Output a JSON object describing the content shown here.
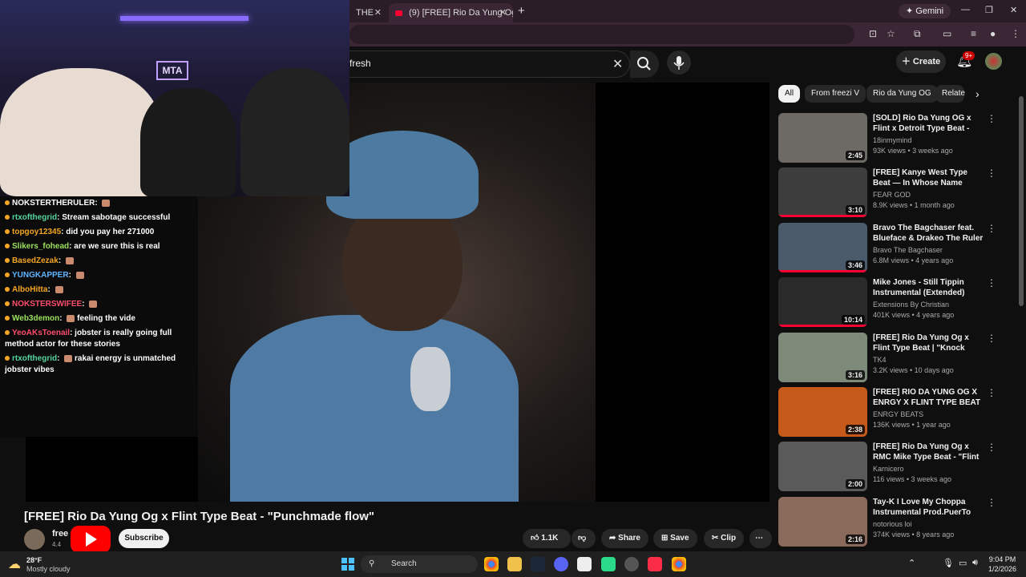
{
  "browser": {
    "tabs": [
      {
        "label": "THE",
        "active": false
      },
      {
        "label": "(9) [FREE] Rio Da Yung Og",
        "active": true
      }
    ],
    "new_tab": "+",
    "gemini": "Gemini"
  },
  "youtube": {
    "search_value": "fresh",
    "create_label": "Create",
    "notif_count": "9+",
    "chips": [
      "All",
      "From freezi V",
      "Rio da Yung OG",
      "Relate"
    ],
    "main": {
      "title": "[FREE] Rio Da Yung Og x Flint Type Beat - \"Punchmade flow\"",
      "channel": "free",
      "subs": "4.4",
      "subscribe": "Subscribe",
      "likes": "1.1K",
      "share": "Share",
      "save": "Save",
      "clip": "Clip"
    },
    "videos": [
      {
        "title": "[SOLD] Rio Da Yung OG x Flint x Detroit Type Beat - \"Haunted\"",
        "channel": "18inmymind",
        "meta": "93K views • 3 weeks ago",
        "duration": "2:45",
        "progress": 0
      },
      {
        "title": "[FREE] Kanye West Type Beat — In Whose Name",
        "channel": "FEAR GOD",
        "meta": "8.9K views • 1 month ago",
        "duration": "3:10",
        "progress": 1
      },
      {
        "title": "Bravo The Bagchaser feat. Blueface & Drakeo The Ruler - ...",
        "channel": "Bravo The Bagchaser",
        "meta": "6.8M views • 4 years ago",
        "duration": "3:46",
        "progress": 1
      },
      {
        "title": "Mike Jones - Still Tippin Instrumental (Extended)",
        "channel": "Extensions By Christian",
        "meta": "401K views • 4 years ago",
        "duration": "10:14",
        "progress": 1
      },
      {
        "title": "[FREE] Rio Da Yung Og x Flint Type Beat | \"Knock Knock\"",
        "channel": "TK4",
        "meta": "3.2K views • 10 days ago",
        "duration": "3:16",
        "progress": 0
      },
      {
        "title": "[FREE] RIO DA YUNG OG X ENRGY X FLINT TYPE BEAT ...",
        "channel": "ENRGY BEATS",
        "meta": "136K views • 1 year ago",
        "duration": "2:38",
        "progress": 0
      },
      {
        "title": "[FREE] Rio Da Yung Og x RMC Mike Type Beat - \"Flint Boys\"",
        "channel": "Karnicero",
        "meta": "116 views • 3 weeks ago",
        "duration": "2:00",
        "progress": 0
      },
      {
        "title": "Tay-K I Love My Choppa Instrumental Prod.PuerTo OvR...",
        "channel": "notorious loi",
        "meta": "374K views • 8 years ago",
        "duration": "2:16",
        "progress": 0
      }
    ]
  },
  "stream": {
    "sign": "MTA",
    "chat": [
      {
        "user": "NOKSTERTHERULER",
        "color": "#ffffff",
        "text": "",
        "emote": true
      },
      {
        "user": "rtxofthegrid",
        "color": "#55d6a0",
        "text": "Stream sabotage successful",
        "emote": false
      },
      {
        "user": "topgoy12345",
        "color": "#f5a623",
        "text": "did you pay her 271000",
        "emote": false
      },
      {
        "user": "Slikers_fohead",
        "color": "#9be15d",
        "text": "are we sure this is real",
        "emote": false
      },
      {
        "user": "BasedZezak",
        "color": "#f5a623",
        "text": "",
        "emote": true
      },
      {
        "user": "YUNGKAPPER",
        "color": "#5fb3ff",
        "text": "",
        "emote": true
      },
      {
        "user": "AlboHitta",
        "color": "#f5a623",
        "text": "",
        "emote": true
      },
      {
        "user": "NOKSTERSWIFEE",
        "color": "#ff4d6d",
        "text": "",
        "emote": true
      },
      {
        "user": "Web3demon",
        "color": "#9be15d",
        "text": "feeling the vide",
        "emote": true
      },
      {
        "user": "YeoAKsToenail",
        "color": "#ff4d6d",
        "text": "jobster is really going full method actor for these stories",
        "emote": false
      },
      {
        "user": "rtxofthegrid",
        "color": "#55d6a0",
        "text": "rakai energy is unmatched jobster vibes",
        "emote": true
      }
    ]
  },
  "taskbar": {
    "weather_temp": "28°F",
    "weather_desc": "Mostly cloudy",
    "search": "Search",
    "time": "9:04 PM",
    "date": "1/2/2026"
  }
}
